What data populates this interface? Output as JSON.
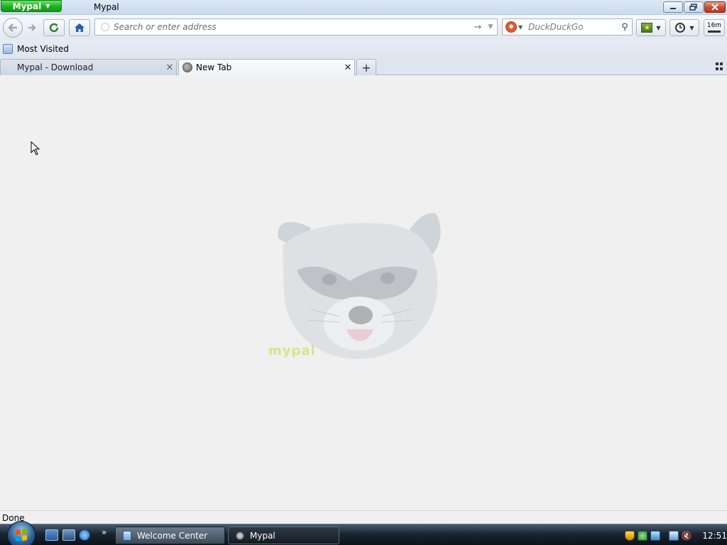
{
  "window": {
    "app_button_label": "Mypal",
    "title": "Mypal"
  },
  "navbar": {
    "url_placeholder": "Search or enter address",
    "search_engine": "DuckDuckGo",
    "download_time": "16m"
  },
  "bookmarks": {
    "items": [
      {
        "label": "Most Visited"
      }
    ]
  },
  "tabs": [
    {
      "label": "Mypal - Download",
      "active": false
    },
    {
      "label": "New Tab",
      "active": true
    }
  ],
  "content": {
    "mascot_label": "mypal"
  },
  "status": {
    "text": "Done"
  },
  "taskbar": {
    "tasks": [
      {
        "label": "Welcome Center"
      },
      {
        "label": "Mypal"
      }
    ],
    "clock": "12:51"
  },
  "colors": {
    "app_button": "#1fb01f",
    "taskbar": "#1a2532",
    "content_bg": "#f0f0f0"
  }
}
